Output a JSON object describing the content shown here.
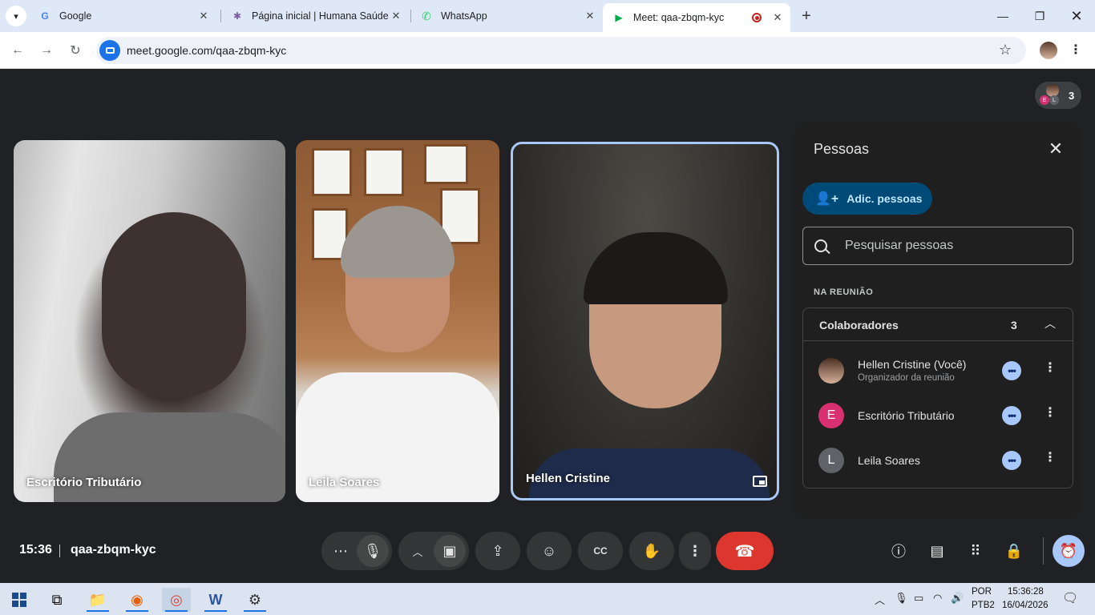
{
  "browser": {
    "tabs": [
      {
        "label": "Google",
        "favicon": "G",
        "favicon_color": "#4285f4"
      },
      {
        "label": "Página inicial | Humana Saúde",
        "favicon": "✱",
        "favicon_color": "#7b5ea7"
      },
      {
        "label": "WhatsApp",
        "favicon": "✆",
        "favicon_color": "#25d366"
      },
      {
        "label": "Meet: qaa-zbqm-kyc",
        "favicon": "▶",
        "favicon_color": "#00ac47",
        "active": true
      }
    ],
    "url": "meet.google.com/qaa-zbqm-kyc"
  },
  "meet": {
    "participant_count": "3",
    "tiles": [
      {
        "name": "Escritório Tributário"
      },
      {
        "name": "Leila Soares"
      },
      {
        "name": "Hellen Cristine"
      }
    ],
    "time": "15:36",
    "meeting_code": "qaa-zbqm-kyc",
    "accent_end_call": "#dc362e"
  },
  "people_panel": {
    "title": "Pessoas",
    "add_label": "Adic. pessoas",
    "search_placeholder": "Pesquisar pessoas",
    "section_label": "NA REUNIÃO",
    "group_title": "Colaboradores",
    "group_count": "3",
    "people": [
      {
        "name": "Hellen Cristine (Você)",
        "subtitle": "Organizador da reunião",
        "initial": "",
        "color": "#5a3a2a"
      },
      {
        "name": "Escritório Tributário",
        "subtitle": "",
        "initial": "E",
        "color": "#d93071"
      },
      {
        "name": "Leila Soares",
        "subtitle": "",
        "initial": "L",
        "color": "#5f6368"
      }
    ]
  },
  "taskbar": {
    "language": "POR",
    "layout": "PTB2",
    "clock_time": "15:36:28",
    "clock_date": "16/04/2026"
  }
}
